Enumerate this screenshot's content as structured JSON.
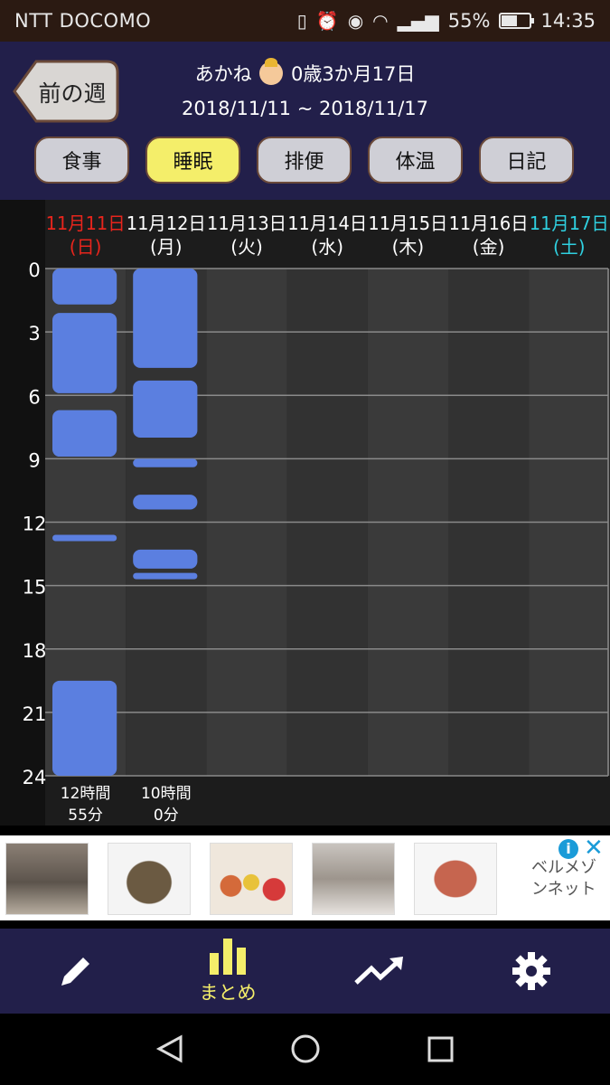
{
  "status_bar": {
    "carrier": "NTT DOCOMO",
    "battery": "55%",
    "battery_level": 0.55,
    "time": "14:35"
  },
  "header": {
    "prev_week_label": "前の週",
    "child_name": "あかね",
    "child_age": "0歳3か月17日",
    "date_range": "2018/11/11 ~ 2018/11/17"
  },
  "tabs": [
    {
      "label": "食事",
      "active": false
    },
    {
      "label": "睡眠",
      "active": true
    },
    {
      "label": "排便",
      "active": false
    },
    {
      "label": "体温",
      "active": false
    },
    {
      "label": "日記",
      "active": false
    }
  ],
  "colors": {
    "sunday": "#e8251c",
    "saturday": "#2fd0e0",
    "sleep_block": "#5b7fe0",
    "active_tab": "#f4ee6a"
  },
  "chart_data": {
    "type": "timeline",
    "days": [
      {
        "date": "11月11日",
        "weekday": "(日)",
        "kind": "sunday",
        "total": [
          "12時間",
          "55分"
        ],
        "sleep": [
          [
            0,
            1.7
          ],
          [
            2.1,
            5.9
          ],
          [
            6.7,
            8.9
          ],
          [
            12.6,
            12.9
          ],
          [
            19.5,
            24
          ]
        ]
      },
      {
        "date": "11月12日",
        "weekday": "(月)",
        "kind": "weekday",
        "total": [
          "10時間",
          "0分"
        ],
        "sleep": [
          [
            0,
            4.7
          ],
          [
            5.3,
            8.0
          ],
          [
            9.0,
            9.4
          ],
          [
            10.7,
            11.4
          ],
          [
            13.3,
            14.2
          ],
          [
            14.4,
            14.7
          ]
        ]
      },
      {
        "date": "11月13日",
        "weekday": "(火)",
        "kind": "weekday",
        "total": [],
        "sleep": []
      },
      {
        "date": "11月14日",
        "weekday": "(水)",
        "kind": "weekday",
        "total": [],
        "sleep": []
      },
      {
        "date": "11月15日",
        "weekday": "(木)",
        "kind": "weekday",
        "total": [],
        "sleep": []
      },
      {
        "date": "11月16日",
        "weekday": "(金)",
        "kind": "weekday",
        "total": [],
        "sleep": []
      },
      {
        "date": "11月17日",
        "weekday": "(土)",
        "kind": "saturday",
        "total": [],
        "sleep": []
      }
    ],
    "y_ticks": [
      "0",
      "3",
      "6",
      "9",
      "12",
      "15",
      "18",
      "21",
      "24"
    ],
    "ylim": [
      0,
      24
    ]
  },
  "ad": {
    "text": "ベルメゾンネット",
    "info_icon": "info-icon",
    "close_icon": "close-icon"
  },
  "bottom_nav": [
    {
      "icon": "pencil-icon",
      "label": ""
    },
    {
      "icon": "bar-chart-icon",
      "label": "まとめ",
      "active": true
    },
    {
      "icon": "trend-icon",
      "label": ""
    },
    {
      "icon": "gear-icon",
      "label": ""
    }
  ]
}
